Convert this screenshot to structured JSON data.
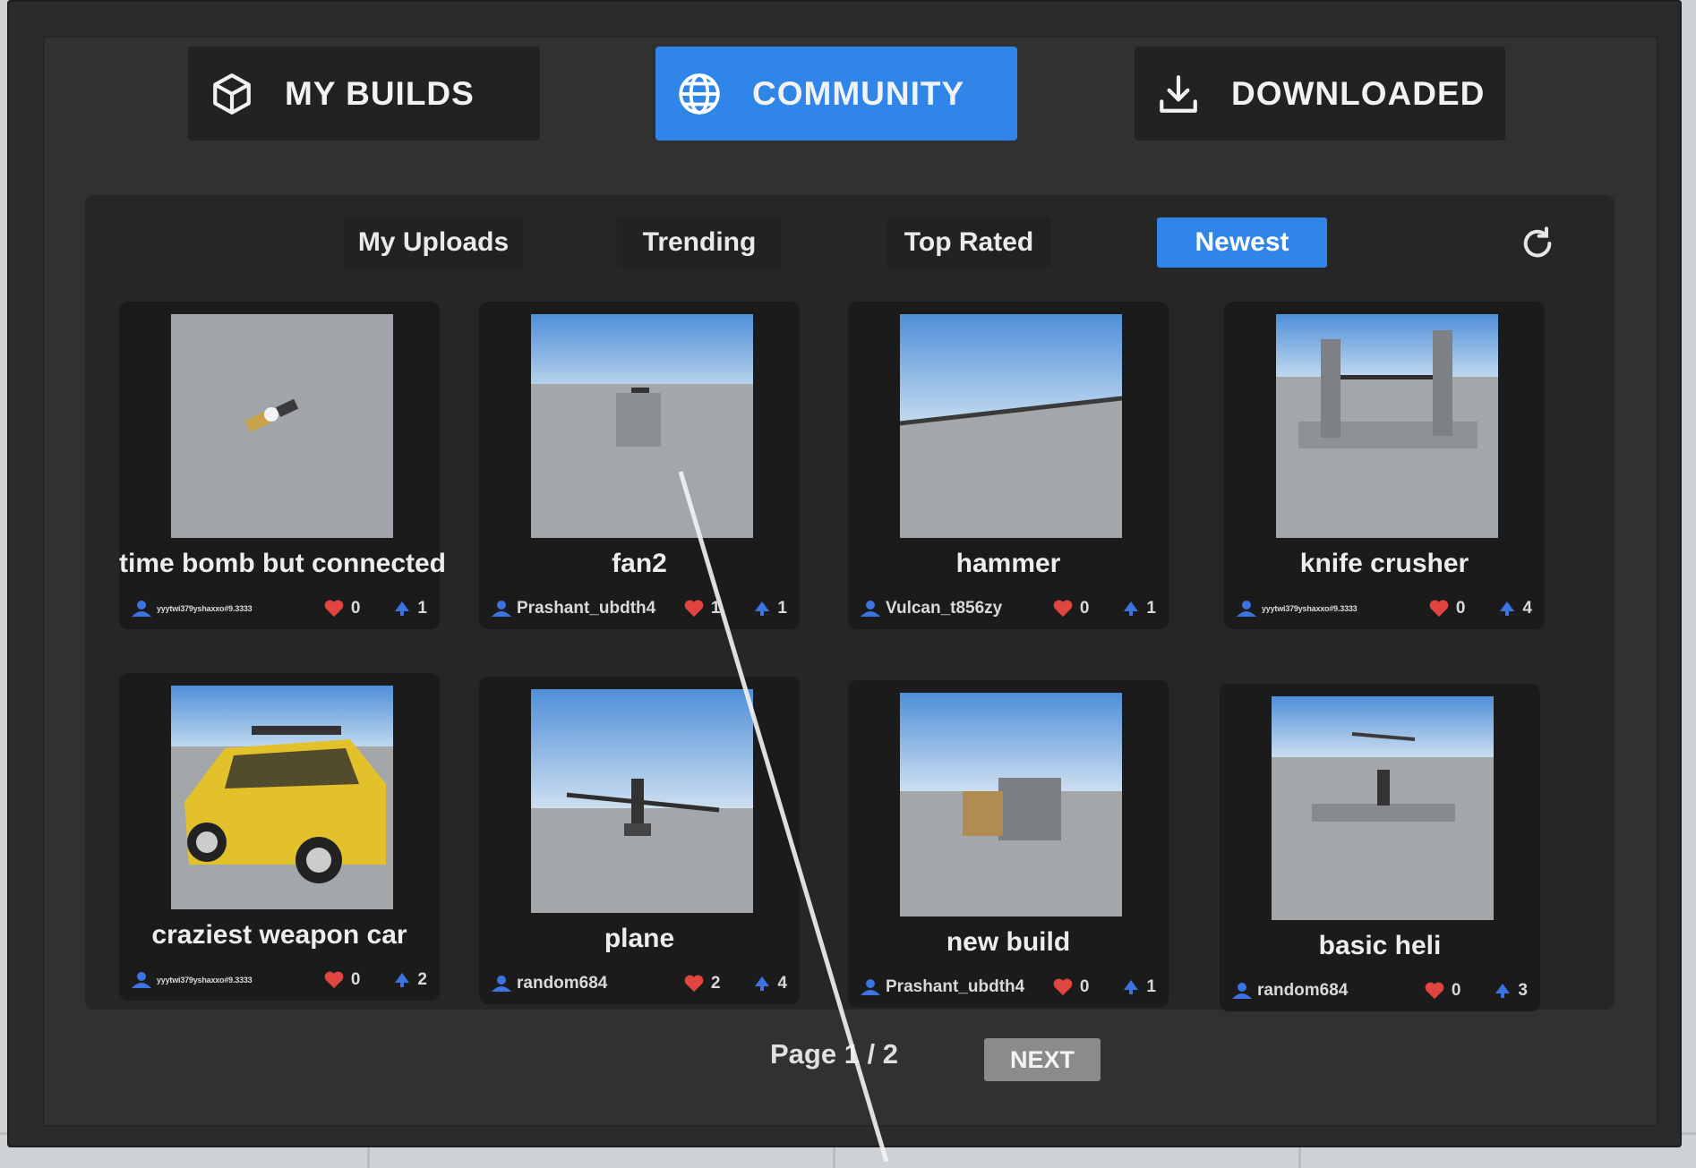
{
  "main_tabs": [
    {
      "label": "MY BUILDS",
      "icon": "cube-icon"
    },
    {
      "label": "COMMUNITY",
      "icon": "globe-icon",
      "active": true
    },
    {
      "label": "DOWNLOADED",
      "icon": "download-icon"
    }
  ],
  "sub_tabs": [
    {
      "label": "My Uploads"
    },
    {
      "label": "Trending"
    },
    {
      "label": "Top Rated"
    },
    {
      "label": "Newest",
      "active": true
    }
  ],
  "refresh_icon": "refresh-icon",
  "builds": [
    {
      "title": "time bomb but connected",
      "author": "yyytwi379yshaxxo#9.3333",
      "likes": "0",
      "downloads": "1"
    },
    {
      "title": "fan2",
      "author": "Prashant_ubdth4",
      "likes": "1",
      "downloads": "1"
    },
    {
      "title": "hammer",
      "author": "Vulcan_t856zy",
      "likes": "0",
      "downloads": "1"
    },
    {
      "title": "knife crusher",
      "author": "yyytwi379yshaxxo#9.3333",
      "likes": "0",
      "downloads": "4"
    },
    {
      "title": "craziest weapon car",
      "author": "yyytwi379yshaxxo#9.3333",
      "likes": "0",
      "downloads": "2"
    },
    {
      "title": "plane",
      "author": "random684",
      "likes": "2",
      "downloads": "4"
    },
    {
      "title": "new build",
      "author": "Prashant_ubdth4",
      "likes": "0",
      "downloads": "1"
    },
    {
      "title": "basic heli",
      "author": "random684",
      "likes": "0",
      "downloads": "3"
    }
  ],
  "pagination": {
    "label": "Page 1 / 2",
    "next_label": "NEXT"
  },
  "colors": {
    "accent": "#2f86e8",
    "like": "#e0453f",
    "author": "#3b74e0"
  }
}
